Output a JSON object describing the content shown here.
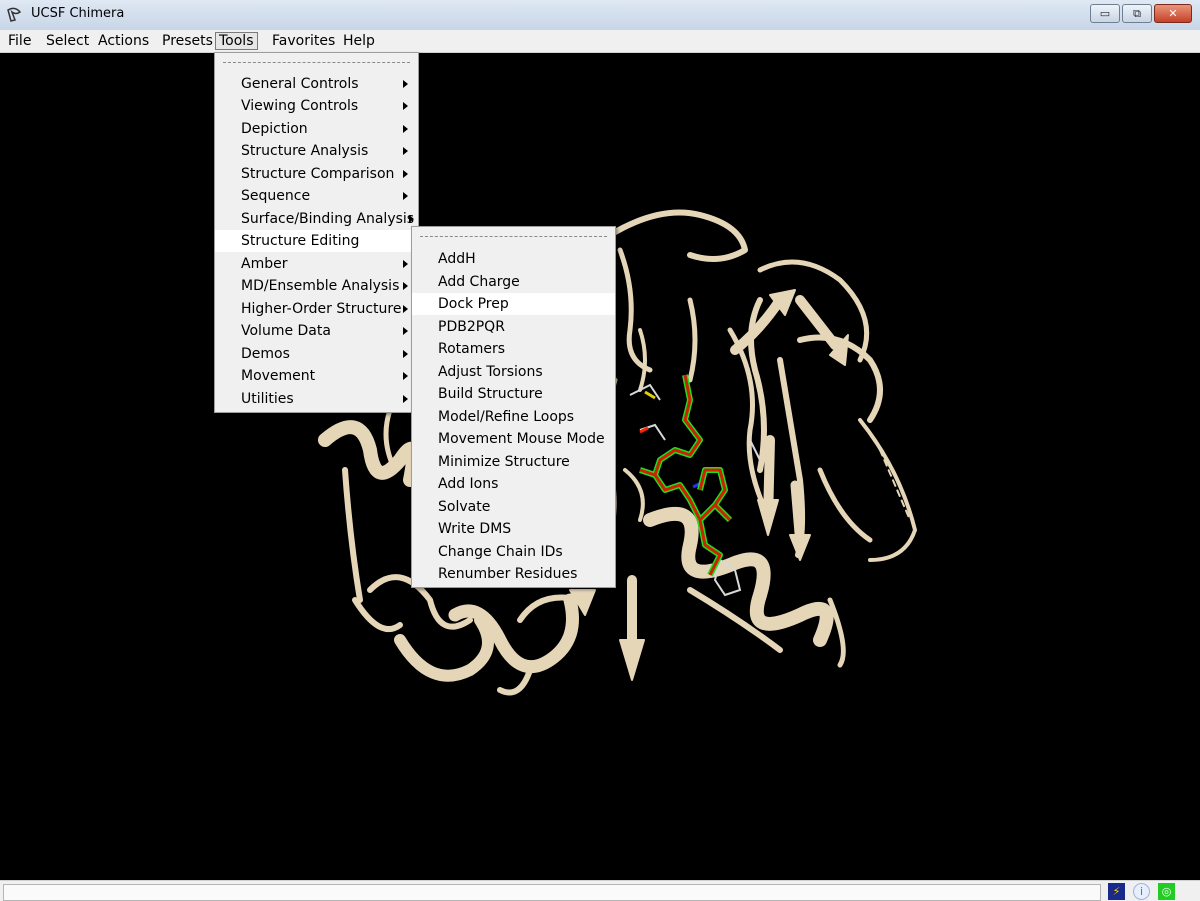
{
  "window": {
    "title": "UCSF Chimera",
    "buttons": {
      "minimize": "▭",
      "maximize": "⧉",
      "close": "✕"
    }
  },
  "menubar": {
    "items": [
      "File",
      "Select",
      "Actions",
      "Presets",
      "Tools",
      "Favorites",
      "Help"
    ],
    "active": "Tools"
  },
  "tools_menu": {
    "items": [
      {
        "label": "General Controls",
        "submenu": true
      },
      {
        "label": "Viewing Controls",
        "submenu": true
      },
      {
        "label": "Depiction",
        "submenu": true
      },
      {
        "label": "Structure Analysis",
        "submenu": true
      },
      {
        "label": "Structure Comparison",
        "submenu": true
      },
      {
        "label": "Sequence",
        "submenu": true
      },
      {
        "label": "Surface/Binding Analysis",
        "submenu": true
      },
      {
        "label": "Structure Editing",
        "submenu": true,
        "highlighted": true
      },
      {
        "label": "Amber",
        "submenu": true
      },
      {
        "label": "MD/Ensemble Analysis",
        "submenu": true
      },
      {
        "label": "Higher-Order Structure",
        "submenu": true
      },
      {
        "label": "Volume Data",
        "submenu": true
      },
      {
        "label": "Demos",
        "submenu": true
      },
      {
        "label": "Movement",
        "submenu": true
      },
      {
        "label": "Utilities",
        "submenu": true
      }
    ]
  },
  "structure_editing_menu": {
    "items": [
      {
        "label": "AddH"
      },
      {
        "label": "Add Charge"
      },
      {
        "label": "Dock Prep",
        "highlighted": true
      },
      {
        "label": "PDB2PQR"
      },
      {
        "label": "Rotamers"
      },
      {
        "label": "Adjust Torsions"
      },
      {
        "label": "Build Structure"
      },
      {
        "label": "Model/Refine Loops"
      },
      {
        "label": "Movement Mouse Mode"
      },
      {
        "label": "Minimize Structure"
      },
      {
        "label": "Add Ions"
      },
      {
        "label": "Solvate"
      },
      {
        "label": "Write DMS"
      },
      {
        "label": "Change Chain IDs"
      },
      {
        "label": "Renumber Residues"
      }
    ]
  },
  "viewport": {
    "background": "#000000",
    "ribbon_color": "#e6d6b8",
    "ligand_color": "#ff2200",
    "ligand_outline": "#22dd22"
  },
  "statusbar": {
    "text": "",
    "icons": [
      "lightning-icon",
      "info-icon",
      "green-status-icon"
    ]
  }
}
